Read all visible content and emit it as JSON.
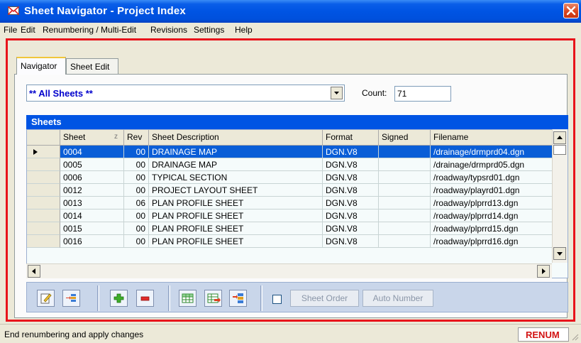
{
  "window": {
    "title": "Sheet Navigator - Project Index"
  },
  "menu": [
    "File",
    "Edit",
    "Renumbering / Multi-Edit",
    "Revisions",
    "Settings",
    "Help"
  ],
  "tabs": [
    {
      "label": "Navigator",
      "active": true
    },
    {
      "label": "Sheet Edit",
      "active": false
    }
  ],
  "filter": {
    "selected": "** All Sheets **",
    "count_label": "Count:",
    "count_value": "71"
  },
  "grid": {
    "caption": "Sheets",
    "columns": [
      "Sheet",
      "Rev",
      "Sheet Description",
      "Format",
      "Signed",
      "Filename"
    ],
    "sort_indicator": "z",
    "rows": [
      {
        "sheet": "0004",
        "rev": "00",
        "desc": "DRAINAGE MAP",
        "format": "DGN.V8",
        "signed": "",
        "file": "/drainage/drmprd04.dgn",
        "selected": true
      },
      {
        "sheet": "0005",
        "rev": "00",
        "desc": "DRAINAGE MAP",
        "format": "DGN.V8",
        "signed": "",
        "file": "/drainage/drmprd05.dgn"
      },
      {
        "sheet": "0006",
        "rev": "00",
        "desc": "TYPICAL SECTION",
        "format": "DGN.V8",
        "signed": "",
        "file": "/roadway/typsrd01.dgn"
      },
      {
        "sheet": "0012",
        "rev": "00",
        "desc": "PROJECT LAYOUT SHEET",
        "format": "DGN.V8",
        "signed": "",
        "file": "/roadway/playrd01.dgn"
      },
      {
        "sheet": "0013",
        "rev": "06",
        "desc": "PLAN PROFILE SHEET",
        "format": "DGN.V8",
        "signed": "",
        "file": "/roadway/plprrd13.dgn"
      },
      {
        "sheet": "0014",
        "rev": "00",
        "desc": "PLAN PROFILE SHEET",
        "format": "DGN.V8",
        "signed": "",
        "file": "/roadway/plprrd14.dgn"
      },
      {
        "sheet": "0015",
        "rev": "00",
        "desc": "PLAN PROFILE SHEET",
        "format": "DGN.V8",
        "signed": "",
        "file": "/roadway/plprrd15.dgn"
      },
      {
        "sheet": "0016",
        "rev": "00",
        "desc": "PLAN PROFILE SHEET",
        "format": "DGN.V8",
        "signed": "",
        "file": "/roadway/plprrd16.dgn"
      }
    ]
  },
  "toolbar": {
    "buttons": [
      "edit-sheet-icon",
      "insert-sheet-icon",
      "add-icon",
      "remove-icon",
      "grid-icon",
      "grid-export-icon",
      "transfer-icon"
    ],
    "sheet_order_label": "Sheet Order",
    "auto_number_label": "Auto Number"
  },
  "status": {
    "text": "End renumbering and apply changes",
    "badge": "RENUM"
  },
  "colors": {
    "title_blue": "#0054e3",
    "selection": "#0a5ed7",
    "frame_red": "#e8141b",
    "badge_red": "#d21313",
    "toolbar_bg": "#c9d6ea"
  }
}
